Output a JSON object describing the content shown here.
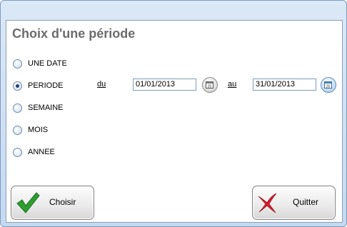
{
  "dialog": {
    "title": "Choix d'une période"
  },
  "options": [
    {
      "label": "UNE DATE",
      "checked": false
    },
    {
      "label": "PERIODE",
      "checked": true
    },
    {
      "label": "SEMAINE",
      "checked": false
    },
    {
      "label": "MOIS",
      "checked": false
    },
    {
      "label": "ANNEE",
      "checked": false
    }
  ],
  "period": {
    "from_label": "du",
    "from_value": "01/01/2013",
    "to_label": "au",
    "to_value": "31/01/2013"
  },
  "buttons": {
    "ok_label": "Choisir",
    "quit_label": "Quitter"
  },
  "colors": {
    "check_green": "#2e9e2e",
    "cross_red": "#d81b2a"
  },
  "icons": {
    "ok": "checkmark-icon",
    "quit": "cross-icon",
    "calendar": "calendar-icon"
  }
}
